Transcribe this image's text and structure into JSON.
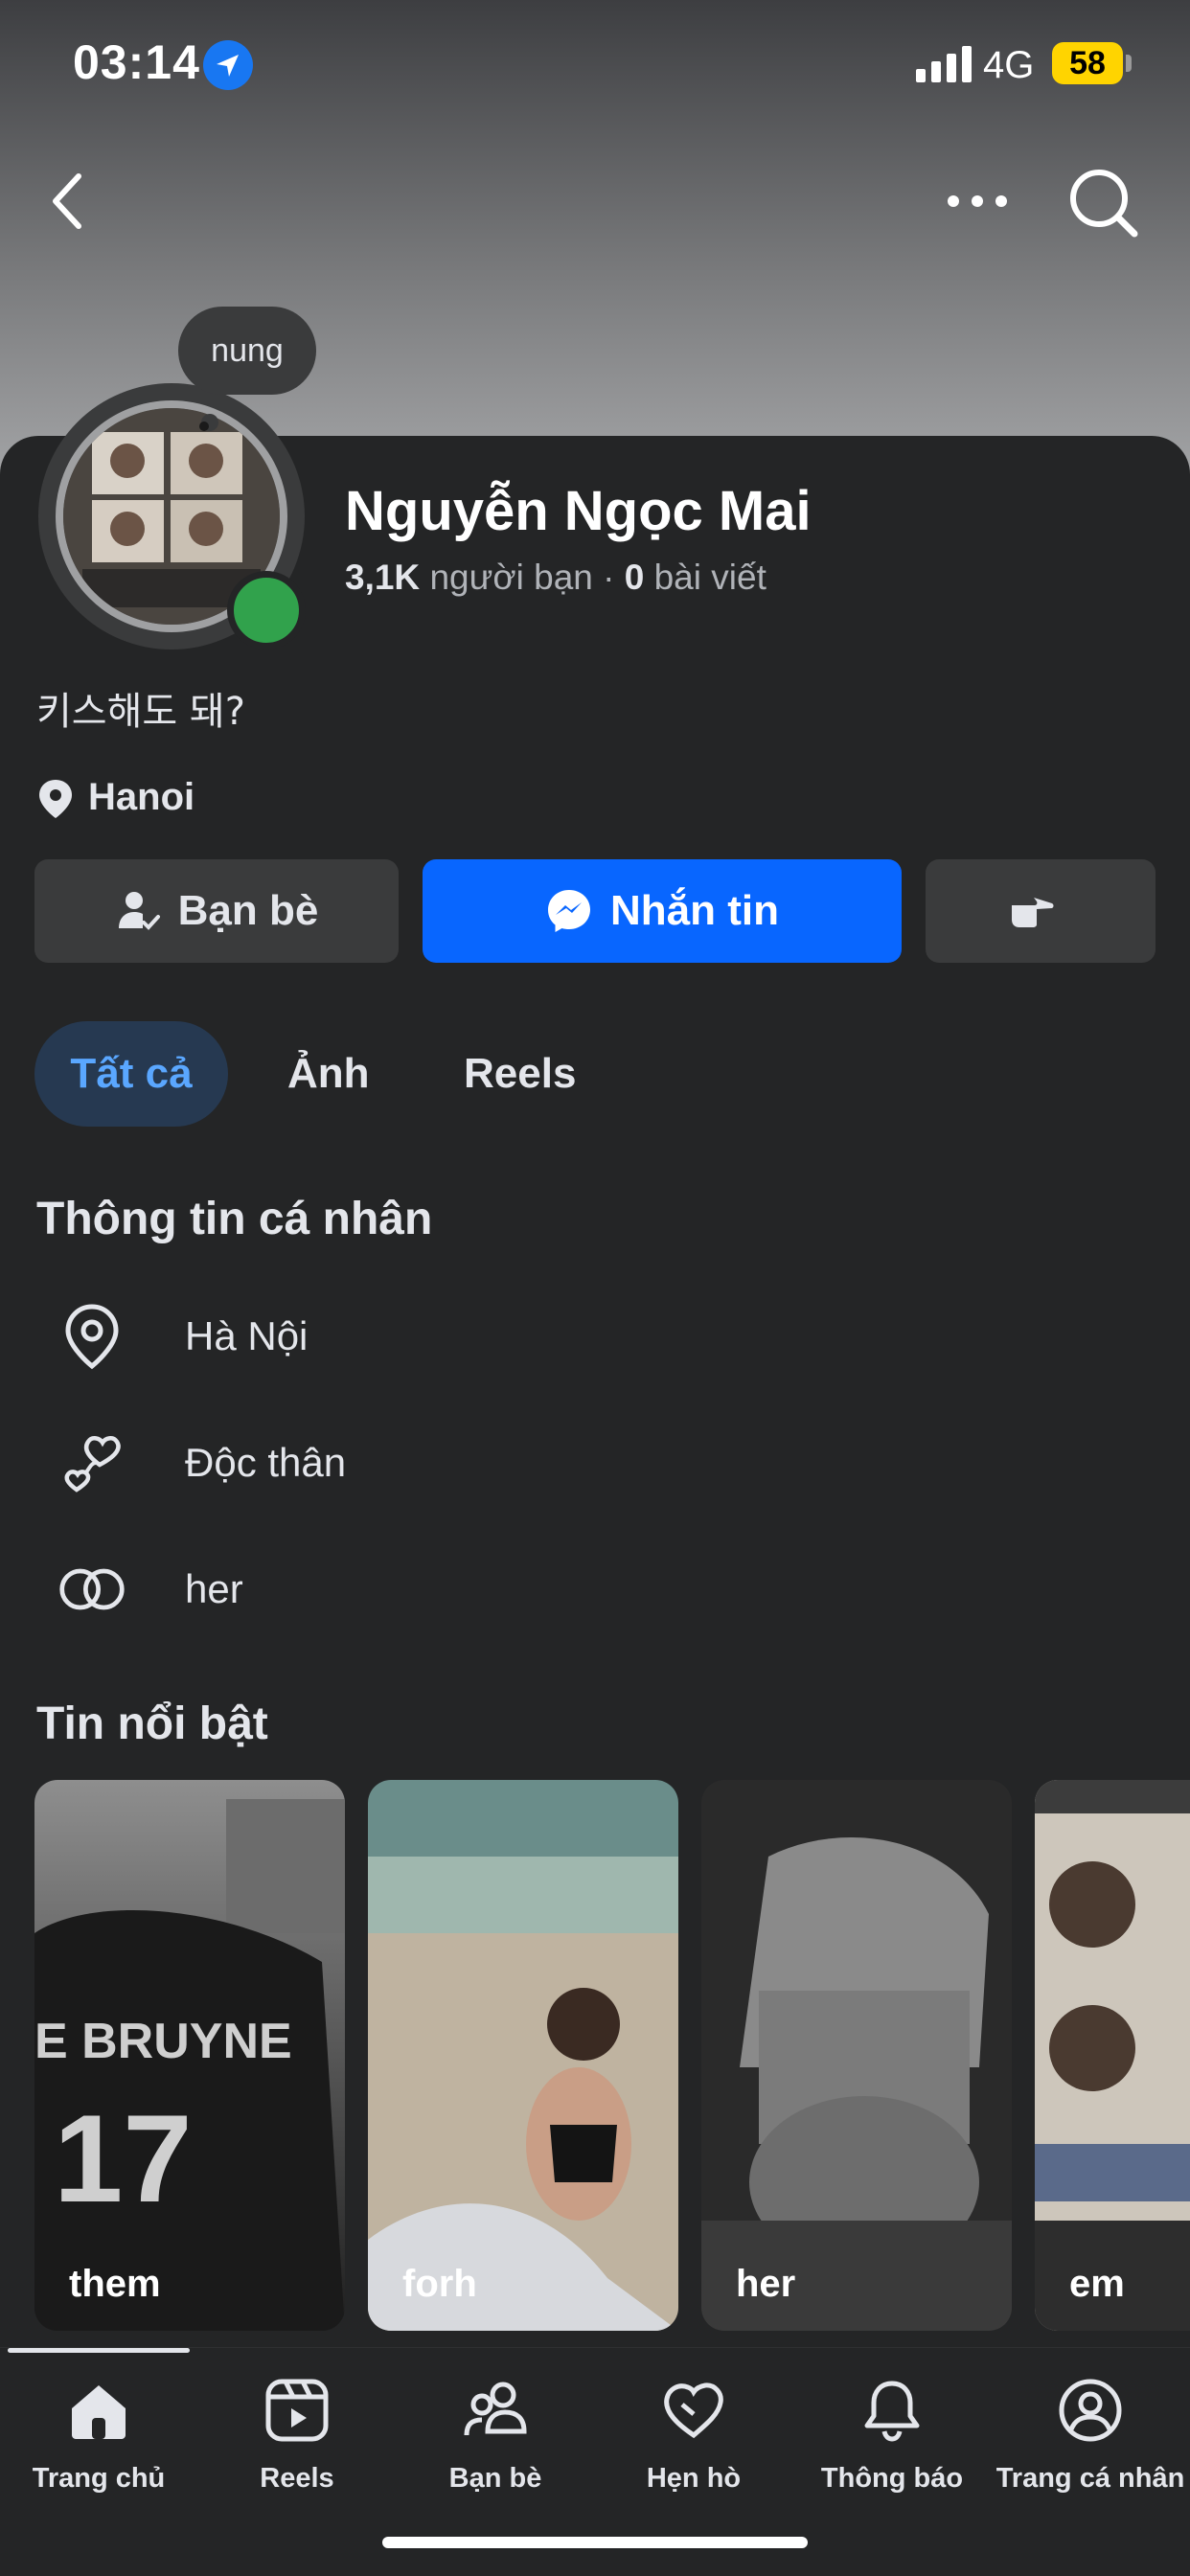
{
  "status_bar": {
    "time": "03:14",
    "network": "4G",
    "battery": "58"
  },
  "profile": {
    "note": "nung",
    "name": "Nguyễn Ngọc Mai",
    "friends_count": "3,1K",
    "friends_label": "người bạn",
    "separator": "·",
    "posts_count": "0",
    "posts_label": "bài viết",
    "bio": "키스해도 돼?",
    "hometown": "Hanoi"
  },
  "actions": {
    "friends": "Bạn bè",
    "message": "Nhắn tin"
  },
  "tabs": [
    "Tất cả",
    "Ảnh",
    "Reels"
  ],
  "about": {
    "title": "Thông tin cá nhân",
    "items": [
      {
        "icon": "location-pin-icon",
        "text": "Hà Nội"
      },
      {
        "icon": "hearts-icon",
        "text": "Độc thân"
      },
      {
        "icon": "rings-icon",
        "text": "her"
      }
    ]
  },
  "highlights": {
    "title": "Tin nổi bật",
    "items": [
      "them",
      "forh",
      "her",
      "em"
    ]
  },
  "bottom_nav": [
    "Trang chủ",
    "Reels",
    "Bạn bè",
    "Hẹn hò",
    "Thông báo",
    "Trang cá nhân"
  ],
  "colors": {
    "accent": "#0866ff",
    "online": "#31a24c",
    "background": "#242526",
    "chip": "#3a3b3c"
  }
}
